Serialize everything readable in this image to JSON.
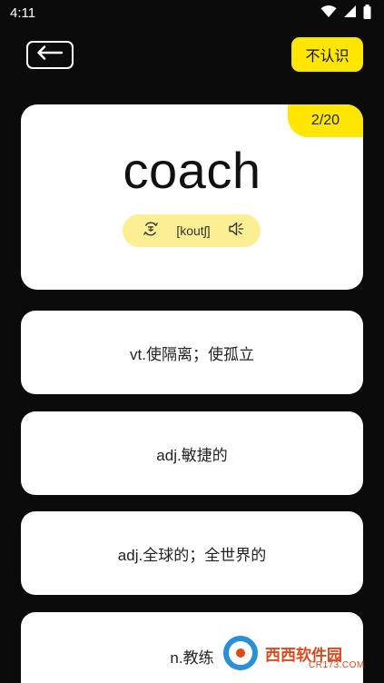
{
  "status_bar": {
    "time": "4:11",
    "icons": [
      "wifi-icon",
      "signal-icon",
      "battery-icon"
    ]
  },
  "header": {
    "back_icon": "arrow-left-icon",
    "unknown_label": "不认识"
  },
  "card": {
    "progress": "2/20",
    "word": "coach",
    "phonetic": "[koutʃ]",
    "icons": [
      "translate-icon",
      "speaker-icon"
    ]
  },
  "options": [
    {
      "label": "vt.使隔离；使孤立"
    },
    {
      "label": "adj.敏捷的"
    },
    {
      "label": "adj.全球的；全世界的"
    },
    {
      "label": "n.教练"
    }
  ],
  "watermark": {
    "text": "西西软件园",
    "sub": "CR173.COM"
  },
  "colors": {
    "background": "#0b0b0b",
    "accent": "#ffe600",
    "pill": "#fcee92",
    "card": "#ffffff"
  }
}
